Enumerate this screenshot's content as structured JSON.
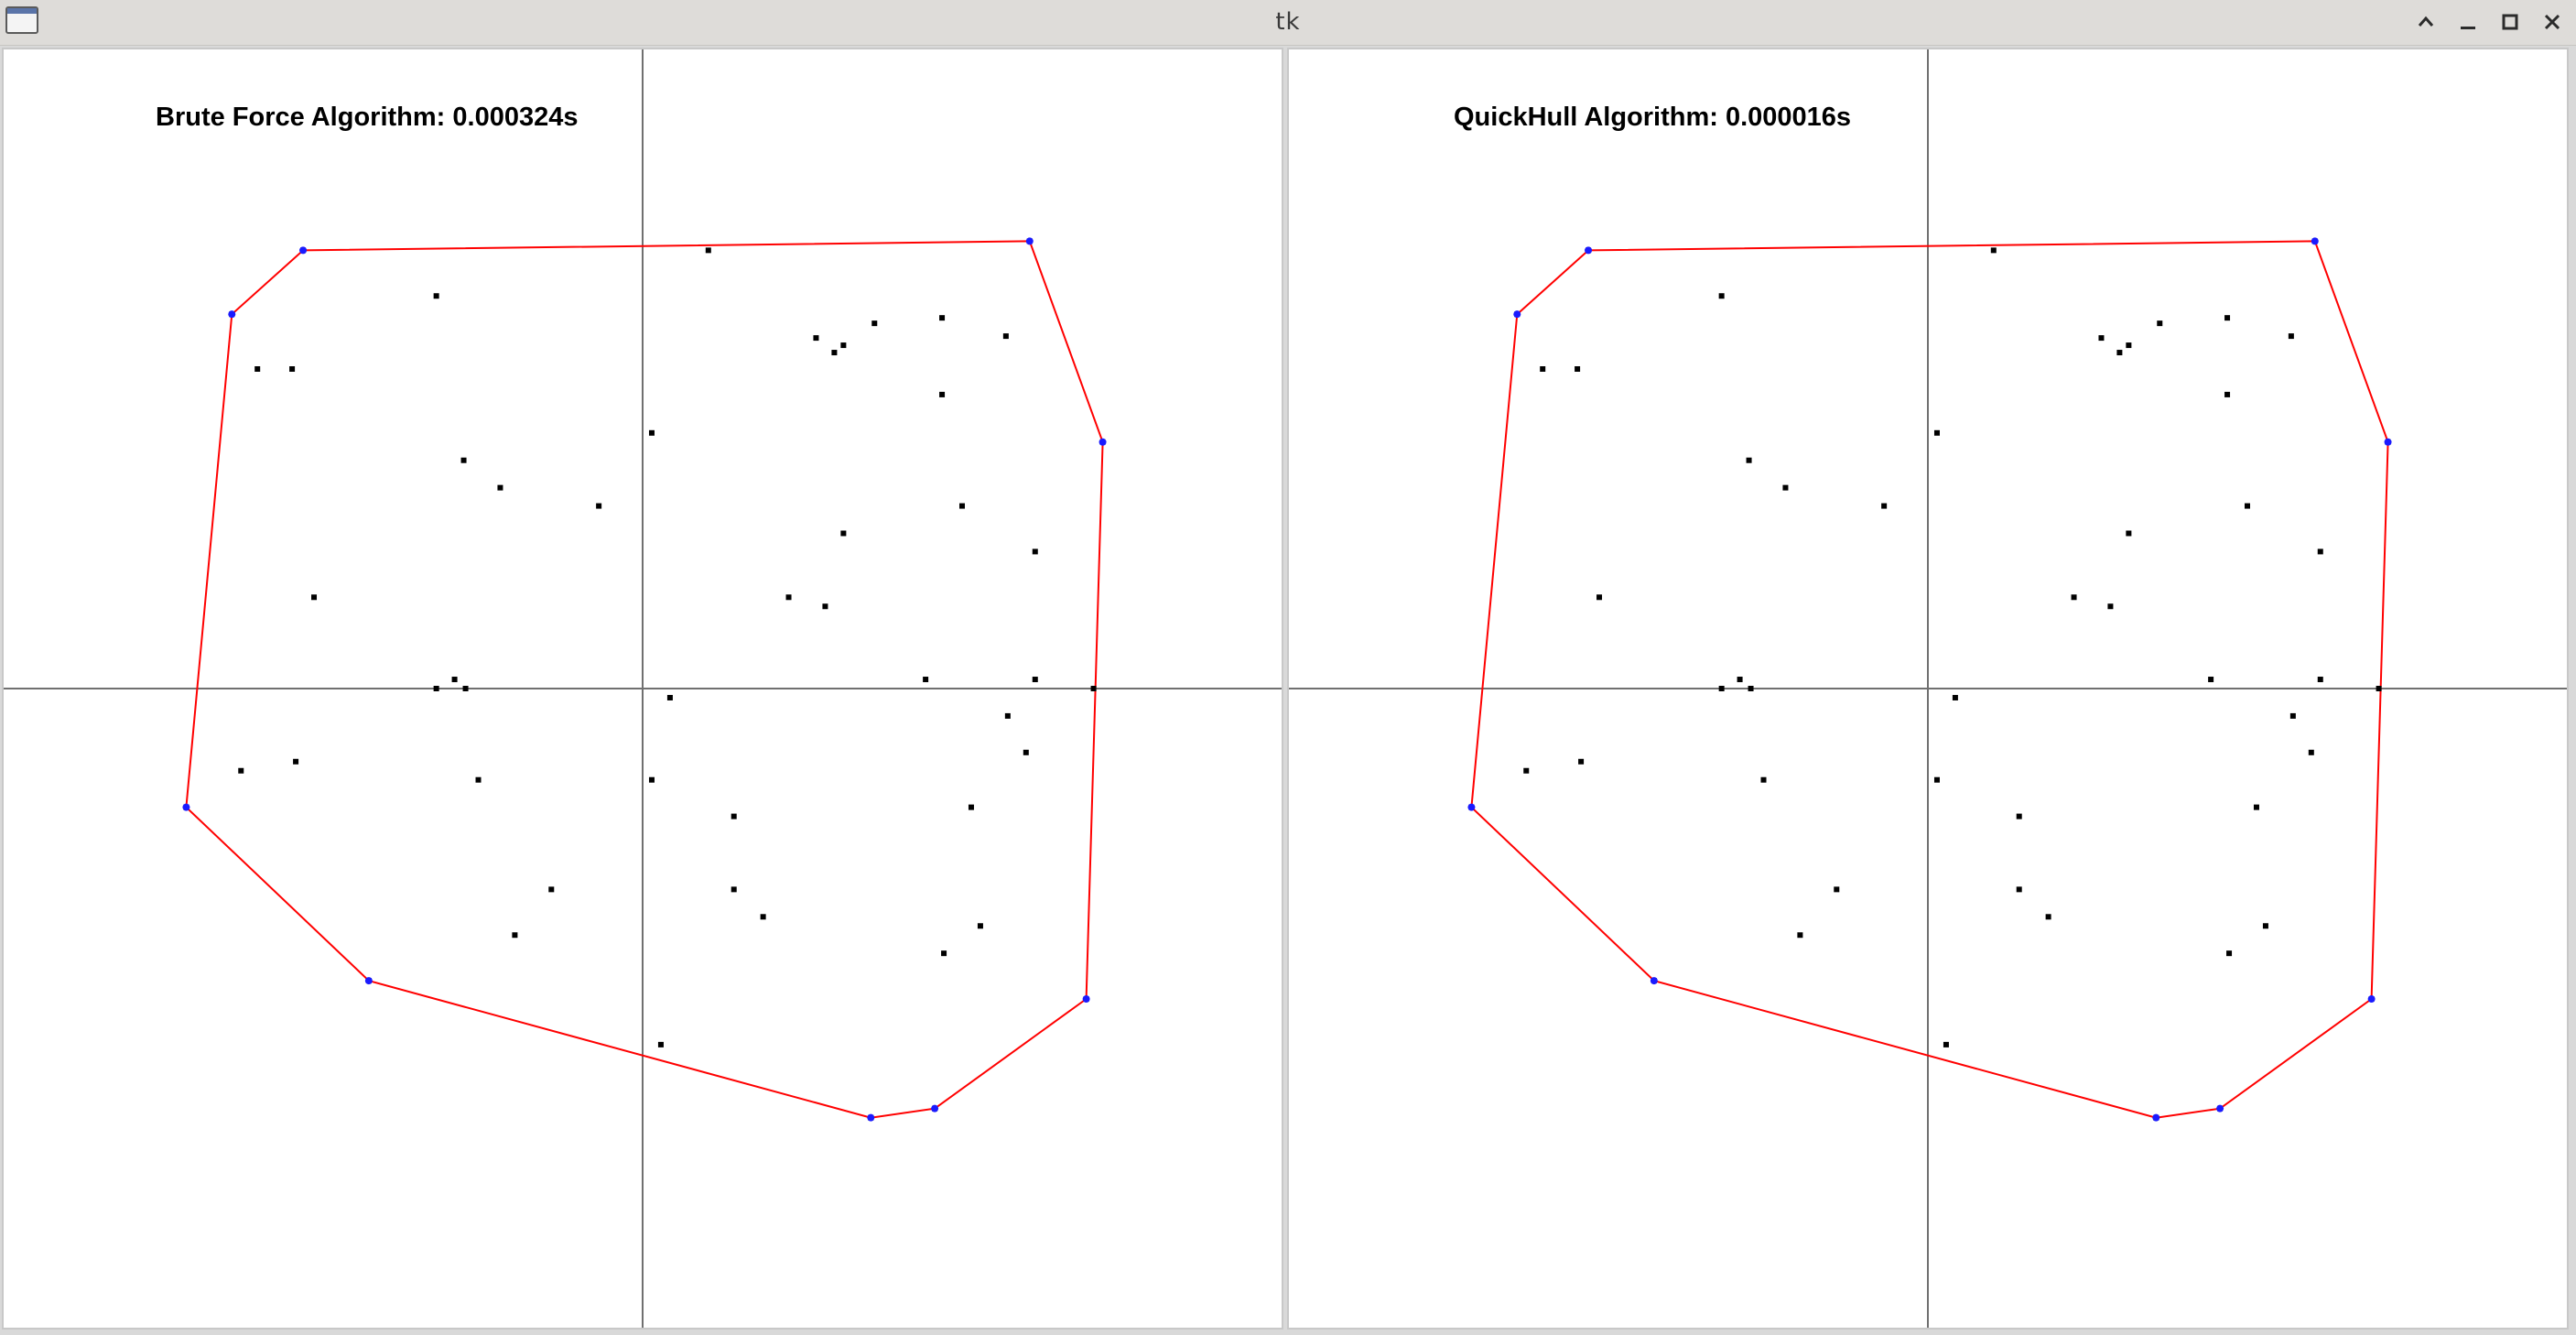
{
  "window": {
    "title": "tk",
    "icon": "tk-window-icon",
    "controls": [
      "shade-icon",
      "minimize-icon",
      "maximize-icon",
      "close-icon"
    ]
  },
  "colors": {
    "hull_line": "#ff0000",
    "hull_vertex": "#1a1aff",
    "point": "#000000",
    "axis": "#707070",
    "panel_bg": "#ffffff"
  },
  "panels": [
    {
      "id": "brute",
      "label": "Brute Force Algorithm: 0.000324s"
    },
    {
      "id": "quick",
      "label": "QuickHull Algorithm: 0.000016s"
    }
  ],
  "chart_data": {
    "type": "scatter",
    "xlim": [
      -350,
      350
    ],
    "ylim": [
      -350,
      350
    ],
    "points": [
      [
        -186,
        240
      ],
      [
        -113,
        215
      ],
      [
        36,
        240
      ],
      [
        212,
        245
      ],
      [
        -225,
        205
      ],
      [
        -192,
        175
      ],
      [
        164,
        203
      ],
      [
        199,
        193
      ],
      [
        95,
        192
      ],
      [
        127,
        200
      ],
      [
        110,
        188
      ],
      [
        105,
        184
      ],
      [
        -211,
        175
      ],
      [
        164,
        161
      ],
      [
        5,
        140
      ],
      [
        -98,
        125
      ],
      [
        -78,
        110
      ],
      [
        -24,
        100
      ],
      [
        175,
        100
      ],
      [
        110,
        85
      ],
      [
        215,
        75
      ],
      [
        252,
        135
      ],
      [
        -180,
        50
      ],
      [
        100,
        45
      ],
      [
        80,
        50
      ],
      [
        -113,
        0
      ],
      [
        -103,
        5
      ],
      [
        -97,
        0
      ],
      [
        155,
        5
      ],
      [
        215,
        5
      ],
      [
        247,
        0
      ],
      [
        15,
        -5
      ],
      [
        200,
        -15
      ],
      [
        -220,
        -45
      ],
      [
        -190,
        -40
      ],
      [
        -90,
        -50
      ],
      [
        5,
        -50
      ],
      [
        210,
        -35
      ],
      [
        180,
        -65
      ],
      [
        -250,
        -65
      ],
      [
        50,
        -70
      ],
      [
        -50,
        -110
      ],
      [
        -70,
        -135
      ],
      [
        50,
        -110
      ],
      [
        66,
        -125
      ],
      [
        185,
        -130
      ],
      [
        165,
        -145
      ],
      [
        -150,
        -160
      ],
      [
        243,
        -170
      ],
      [
        10,
        -195
      ],
      [
        125,
        -235
      ],
      [
        160,
        -230
      ]
    ],
    "hull": [
      [
        -186,
        240
      ],
      [
        212,
        245
      ],
      [
        252,
        135
      ],
      [
        243,
        -170
      ],
      [
        160,
        -230
      ],
      [
        125,
        -235
      ],
      [
        -150,
        -160
      ],
      [
        -250,
        -65
      ],
      [
        -225,
        205
      ]
    ]
  }
}
